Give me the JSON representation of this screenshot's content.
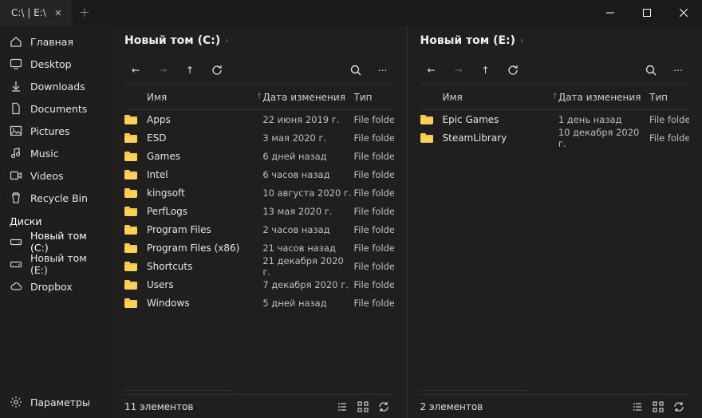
{
  "window_title": "C:\\  |  E:\\",
  "sidebar": {
    "items": [
      {
        "id": "home",
        "label": "Главная"
      },
      {
        "id": "desktop",
        "label": "Desktop"
      },
      {
        "id": "downloads",
        "label": "Downloads"
      },
      {
        "id": "documents",
        "label": "Documents"
      },
      {
        "id": "pictures",
        "label": "Pictures"
      },
      {
        "id": "music",
        "label": "Music"
      },
      {
        "id": "videos",
        "label": "Videos"
      },
      {
        "id": "recycle",
        "label": "Recycle Bin"
      }
    ],
    "drives_header": "Диски",
    "drives": [
      {
        "id": "drive-c",
        "label": "Новый том (C:)"
      },
      {
        "id": "drive-e",
        "label": "Новый том (E:)"
      },
      {
        "id": "dropbox",
        "label": "Dropbox"
      }
    ],
    "settings_label": "Параметры"
  },
  "panes": [
    {
      "breadcrumb": "Новый том (C:)",
      "columns": {
        "name": "Имя",
        "date": "Дата изменения",
        "type": "Тип"
      },
      "type_value": "File folder",
      "items": [
        {
          "name": "Apps",
          "date": "22 июня 2019 г."
        },
        {
          "name": "ESD",
          "date": "3 мая 2020 г."
        },
        {
          "name": "Games",
          "date": "6 дней назад"
        },
        {
          "name": "Intel",
          "date": "6 часов назад"
        },
        {
          "name": "kingsoft",
          "date": "10 августа 2020 г."
        },
        {
          "name": "PerfLogs",
          "date": "13 мая 2020 г."
        },
        {
          "name": "Program Files",
          "date": "2 часов назад"
        },
        {
          "name": "Program Files (x86)",
          "date": "21 часов назад"
        },
        {
          "name": "Shortcuts",
          "date": "21 декабря 2020 г."
        },
        {
          "name": "Users",
          "date": "7 декабря 2020 г."
        },
        {
          "name": "Windows",
          "date": "5 дней назад"
        }
      ],
      "status": "11 элементов"
    },
    {
      "breadcrumb": "Новый том (E:)",
      "columns": {
        "name": "Имя",
        "date": "Дата изменения",
        "type": "Тип"
      },
      "type_value": "File folder",
      "items": [
        {
          "name": "Epic Games",
          "date": "1 день назад"
        },
        {
          "name": "SteamLibrary",
          "date": "10 декабря 2020 г."
        }
      ],
      "status": "2 элементов"
    }
  ]
}
